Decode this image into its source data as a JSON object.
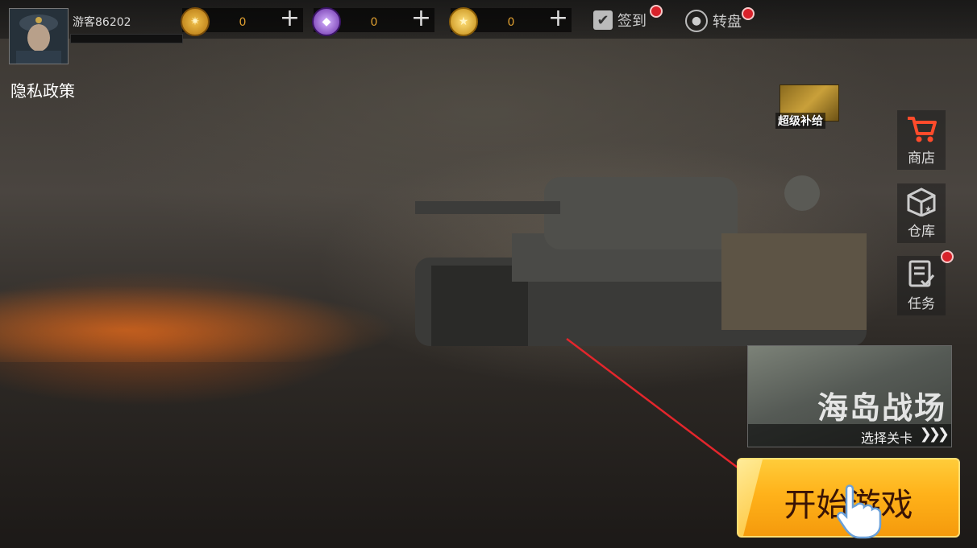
{
  "player": {
    "name": "游客86202"
  },
  "resources": [
    {
      "icon": "gold-medal-icon",
      "value": "0",
      "color": "#c98a1e"
    },
    {
      "icon": "purple-gem-icon",
      "value": "0",
      "color": "#8a4fc7"
    },
    {
      "icon": "gold-coin-icon",
      "value": "0",
      "color": "#d8a326"
    }
  ],
  "top_actions": {
    "checkin": "签到",
    "wheel": "转盘"
  },
  "privacy": "隐私政策",
  "supply": "超级补给",
  "side_menu": {
    "shop": "商店",
    "warehouse": "仓库",
    "tasks": "任务"
  },
  "map_card": {
    "title": "海岛战场",
    "subtitle": "选择关卡"
  },
  "start_button": "开始游戏",
  "colors": {
    "badge": "#d8222a",
    "start_button": "#ffb21a",
    "arrow": "#e3262c"
  }
}
